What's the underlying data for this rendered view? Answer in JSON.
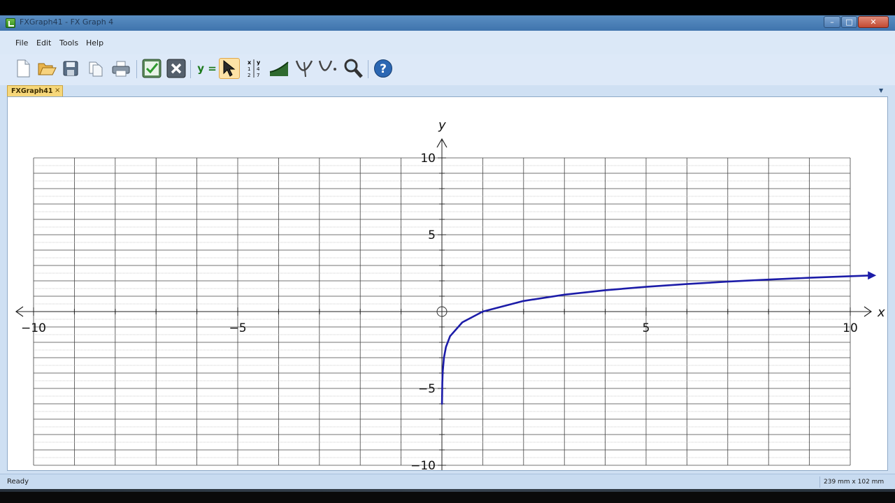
{
  "window": {
    "title": "FXGraph41 - FX Graph 4",
    "controls": {
      "minimize": "–",
      "maximize": "□",
      "close": "✕"
    }
  },
  "menu": {
    "items": [
      "File",
      "Edit",
      "Tools",
      "Help"
    ]
  },
  "toolbar": {
    "equation_label": "y =",
    "buttons": [
      "new-file-icon",
      "open-folder-icon",
      "save-icon",
      "copy-icon",
      "print-icon",
      "check-icon",
      "cancel-icon",
      "equation-icon",
      "pointer-icon",
      "table-icon",
      "area-icon",
      "tangent-icon",
      "derivative-icon",
      "zoom-icon",
      "help-icon"
    ]
  },
  "tab": {
    "label": "FXGraph41",
    "close": "×"
  },
  "status": {
    "text": "Ready",
    "size": "239 mm x 102 mm"
  },
  "colors": {
    "curve": "#1c1ca8",
    "grid_major": "#444444",
    "grid_minor": "#999999"
  },
  "chart_data": {
    "type": "line",
    "xlabel": "x",
    "ylabel": "y",
    "xlim": [
      -10,
      10
    ],
    "ylim": [
      -10,
      10
    ],
    "x_ticks": [
      -10,
      -5,
      5,
      10
    ],
    "y_ticks": [
      10,
      5,
      -5,
      -10
    ],
    "grid": true,
    "series": [
      {
        "x": [
          0.0025,
          0.01,
          0.02,
          0.05,
          0.1,
          0.2,
          0.5,
          1,
          2,
          3,
          4,
          5,
          6,
          7,
          8,
          9,
          10.5
        ],
        "y": [
          -6,
          -4.6,
          -3.9,
          -3.0,
          -2.3,
          -1.6,
          -0.7,
          0,
          0.69,
          1.1,
          1.39,
          1.61,
          1.79,
          1.95,
          2.08,
          2.2,
          2.35
        ]
      }
    ]
  }
}
